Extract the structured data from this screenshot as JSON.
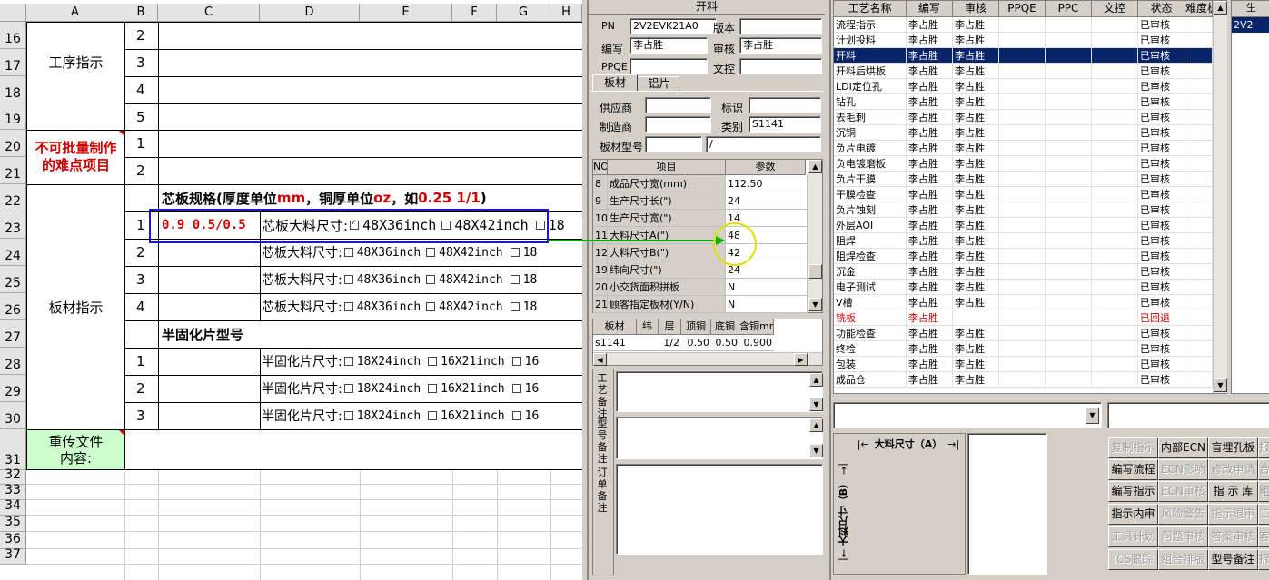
{
  "sheet": {
    "columns": [
      "A",
      "B",
      "C",
      "D",
      "E",
      "F",
      "G",
      "H"
    ],
    "rows": [
      "16",
      "17",
      "18",
      "19",
      "20",
      "21",
      "22",
      "23",
      "24",
      "25",
      "26",
      "27",
      "28",
      "29",
      "30",
      "31",
      "32",
      "33",
      "34",
      "35",
      "36",
      "37"
    ],
    "process_label": "工序指示",
    "process_nums": [
      "2",
      "3",
      "4",
      "5"
    ],
    "difficult_label_1": "不可批量制作",
    "difficult_label_2": "的难点项目",
    "difficult_nums": [
      "1",
      "2"
    ],
    "board_label": "板材指示",
    "core_spec_title": "芯板规格(厚度单位mm，铜厚单位oz，如0.25 1/1)",
    "core_spec_t1": "芯板规格(厚度单位",
    "core_spec_mm": "mm",
    "core_spec_t2": "，铜厚单位",
    "core_spec_oz": "oz",
    "core_spec_t3": "，如",
    "core_spec_ex": "0.25 1/1",
    "core_spec_t4": ")",
    "board_rows": [
      {
        "num": "1",
        "spec": "0.9 0.5/0.5",
        "label": "芯板大料尺寸:",
        "opt1": "48X36inch",
        "opt2": "48X42inch",
        "opt3": "18",
        "checked": true
      },
      {
        "num": "2",
        "spec": "",
        "label": "芯板大料尺寸:",
        "opt1": "48X36inch",
        "opt2": "48X42inch",
        "opt3": "18",
        "checked": false
      },
      {
        "num": "3",
        "spec": "",
        "label": "芯板大料尺寸:",
        "opt1": "48X36inch",
        "opt2": "48X42inch",
        "opt3": "18",
        "checked": false
      },
      {
        "num": "4",
        "spec": "",
        "label": "芯板大料尺寸:",
        "opt1": "48X36inch",
        "opt2": "48X42inch",
        "opt3": "18",
        "checked": false
      }
    ],
    "prepreg_title": "半固化片型号",
    "prepreg_rows": [
      {
        "num": "1",
        "label": "半固化片尺寸:",
        "opt1": "18X24inch",
        "opt2": "16X21inch",
        "opt3": "16"
      },
      {
        "num": "2",
        "label": "半固化片尺寸:",
        "opt1": "18X24inch",
        "opt2": "16X21inch",
        "opt3": "16"
      },
      {
        "num": "3",
        "label": "半固化片尺寸:",
        "opt1": "18X24inch",
        "opt2": "16X21inch",
        "opt3": "16"
      }
    ],
    "reupload_label_1": "重传文件",
    "reupload_label_2": "内容:"
  },
  "mid": {
    "title": "开料",
    "pn_label": "PN",
    "pn_value": "2V2EVK21A0",
    "version_label": "版本",
    "version_value": "",
    "author_label": "编写",
    "author_value": "李占胜",
    "review_label": "审核",
    "review_value": "李占胜",
    "ppqe_label": "PPQE",
    "ppqe_value": "",
    "doc_label": "文控",
    "doc_value": "",
    "tabs": [
      "板材",
      "铝片"
    ],
    "supplier_label": "供应商",
    "supplier_value": "",
    "mark_label": "标识",
    "mark_value": "",
    "maker_label": "制造商",
    "maker_value": "",
    "category_label": "类别",
    "category_value": "S1141",
    "model_label": "板材型号",
    "model_value": "",
    "model_value2": "/",
    "param_headers": [
      "NO",
      "项目",
      "参数"
    ],
    "params": [
      {
        "no": "8",
        "item": "成品尺寸宽(mm)",
        "val": "112.50"
      },
      {
        "no": "9",
        "item": "生产尺寸长(\")",
        "val": "24"
      },
      {
        "no": "10",
        "item": "生产尺寸宽(\")",
        "val": "14"
      },
      {
        "no": "11",
        "item": "大料尺寸A(\")",
        "val": "48"
      },
      {
        "no": "12",
        "item": "大料尺寸B(\")",
        "val": "42"
      },
      {
        "no": "19",
        "item": "纬向尺寸(\")",
        "val": "24"
      },
      {
        "no": "20",
        "item": "小交货面积拼板",
        "val": "N"
      },
      {
        "no": "21",
        "item": "顾客指定板材(Y/N)",
        "val": "N"
      }
    ],
    "mat_headers": [
      "板材",
      "纬",
      "层",
      "顶铜",
      "底铜",
      "含铜mm"
    ],
    "mat_row": [
      "s1141",
      "",
      "1/2",
      "0.50",
      "0.50",
      "0.900"
    ],
    "note_labels": [
      "工艺备注",
      "型号备注",
      "订单备注"
    ]
  },
  "right": {
    "headers": [
      "工艺名称",
      "编写",
      "审核",
      "PPQE",
      "PPC",
      "文控",
      "状态",
      "难度板"
    ],
    "side_header": "生",
    "side_value": "2V2",
    "rows": [
      {
        "name": "流程指示",
        "author": "李占胜",
        "review": "李占胜",
        "status": "已审核"
      },
      {
        "name": "计划投料",
        "author": "李占胜",
        "review": "李占胜",
        "status": "已审核"
      },
      {
        "name": "开料",
        "author": "李占胜",
        "review": "李占胜",
        "status": "已审核"
      },
      {
        "name": "开料后烘板",
        "author": "李占胜",
        "review": "李占胜",
        "status": "已审核"
      },
      {
        "name": "LDI定位孔",
        "author": "李占胜",
        "review": "李占胜",
        "status": "已审核"
      },
      {
        "name": "钻孔",
        "author": "李占胜",
        "review": "李占胜",
        "status": "已审核"
      },
      {
        "name": "去毛刺",
        "author": "李占胜",
        "review": "李占胜",
        "status": "已审核"
      },
      {
        "name": "沉铜",
        "author": "李占胜",
        "review": "李占胜",
        "status": "已审核"
      },
      {
        "name": "负片电镀",
        "author": "李占胜",
        "review": "李占胜",
        "status": "已审核"
      },
      {
        "name": "负电镀磨板",
        "author": "李占胜",
        "review": "李占胜",
        "status": "已审核"
      },
      {
        "name": "负片干膜",
        "author": "李占胜",
        "review": "李占胜",
        "status": "已审核"
      },
      {
        "name": "干膜检查",
        "author": "李占胜",
        "review": "李占胜",
        "status": "已审核"
      },
      {
        "name": "负片蚀刻",
        "author": "李占胜",
        "review": "李占胜",
        "status": "已审核"
      },
      {
        "name": "外层AOI",
        "author": "李占胜",
        "review": "李占胜",
        "status": "已审核"
      },
      {
        "name": "阻焊",
        "author": "李占胜",
        "review": "李占胜",
        "status": "已审核"
      },
      {
        "name": "阻焊检查",
        "author": "李占胜",
        "review": "李占胜",
        "status": "已审核"
      },
      {
        "name": "沉金",
        "author": "李占胜",
        "review": "李占胜",
        "status": "已审核"
      },
      {
        "name": "电子测试",
        "author": "李占胜",
        "review": "李占胜",
        "status": "已审核"
      },
      {
        "name": "V槽",
        "author": "李占胜",
        "review": "李占胜",
        "status": "已审核"
      },
      {
        "name": "铣板",
        "author": "李占胜",
        "review": "",
        "status": "已回退"
      },
      {
        "name": "功能检查",
        "author": "李占胜",
        "review": "李占胜",
        "status": "已审核"
      },
      {
        "name": "终检",
        "author": "李占胜",
        "review": "李占胜",
        "status": "已审核"
      },
      {
        "name": "包装",
        "author": "李占胜",
        "review": "李占胜",
        "status": "已审核"
      },
      {
        "name": "成品仓",
        "author": "李占胜",
        "review": "李占胜",
        "status": "已审核"
      }
    ],
    "diagram_a": "大料尺寸（A）",
    "diagram_b": "大料尺寸（B）",
    "buttons": [
      [
        "复制指示",
        "内部ECN",
        "盲埋孔板",
        "报"
      ],
      [
        "编写流程",
        "ECN影响",
        "修改申请",
        "合"
      ],
      [
        "编写指示",
        "ECN审核",
        "指 示 库",
        "粗"
      ],
      [
        "指示内审",
        "风险警告",
        "指示退审",
        "工"
      ],
      [
        "工具计划",
        "问题审核",
        "答案审核",
        "客"
      ],
      [
        "ICS跟踪",
        "组合排版",
        "型号备注",
        "拆"
      ]
    ],
    "disabled": [
      [
        true,
        false,
        false,
        true
      ],
      [
        false,
        true,
        true,
        true
      ],
      [
        false,
        true,
        false,
        true
      ],
      [
        false,
        true,
        true,
        true
      ],
      [
        true,
        true,
        true,
        true
      ],
      [
        true,
        true,
        false,
        true
      ]
    ]
  },
  "colors": {
    "red": "#cc0000",
    "selection": "#0a246a",
    "annot_blue": "#1a1acc",
    "annot_green": "#00b000",
    "annot_yellow": "#e0e000",
    "green_cell": "#ccffcc"
  }
}
